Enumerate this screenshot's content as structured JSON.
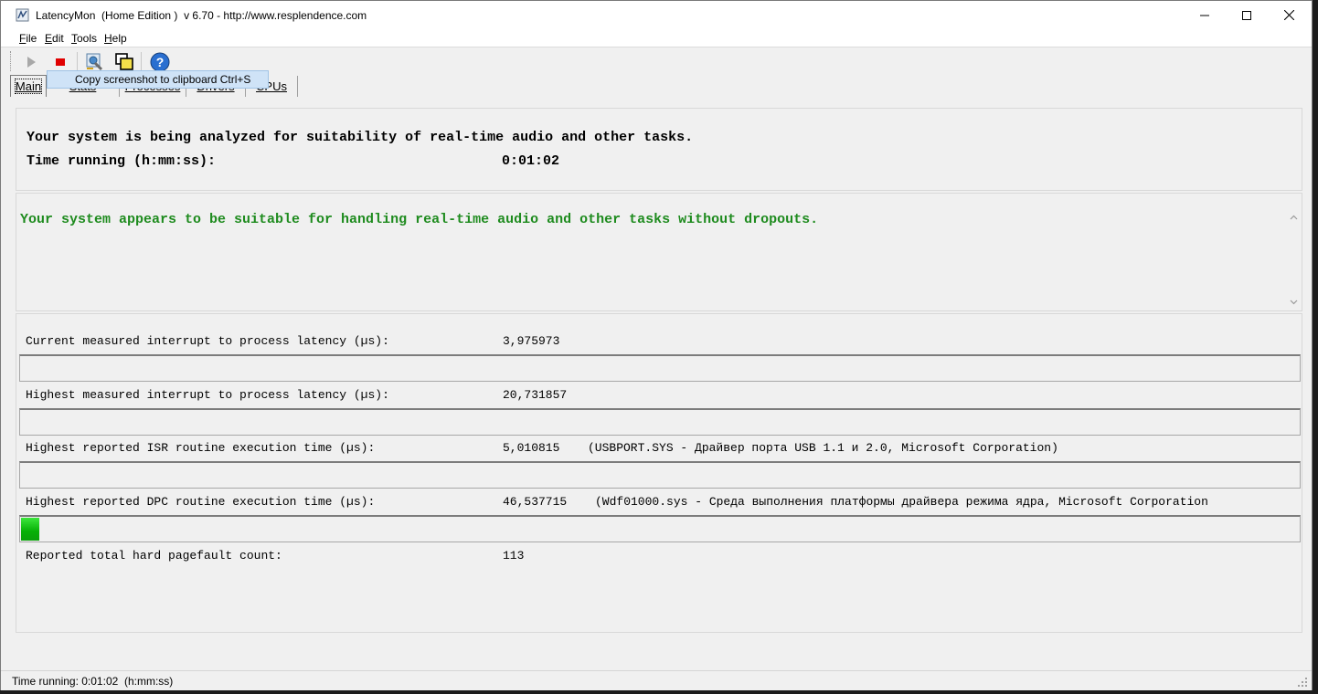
{
  "window": {
    "title": "LatencyMon  (Home Edition )  v 6.70 - http://www.resplendence.com",
    "minimize_glyph": "—",
    "maximize_glyph": "☐",
    "close_glyph": "✕"
  },
  "menu": {
    "file": {
      "u": "F",
      "rest": "ile"
    },
    "edit": {
      "u": "E",
      "rest": "dit"
    },
    "tools": {
      "u": "T",
      "rest": "ools"
    },
    "help": {
      "u": "H",
      "rest": "elp"
    }
  },
  "toolbar": {
    "icons": [
      "play-icon",
      "stop-icon",
      "gear-wrench-icon",
      "copy-windows-icon",
      "help-icon"
    ]
  },
  "tooltip": "Copy screenshot to clipboard Ctrl+S",
  "tabs": [
    {
      "label": "Main",
      "active": true
    },
    {
      "label": "Stats"
    },
    {
      "label": "Processes"
    },
    {
      "label": "Drivers"
    },
    {
      "label": "CPUs"
    }
  ],
  "summary": {
    "line1": "Your system is being analyzed for suitability of real-time audio and other tasks.",
    "time_label": "Time running (h:mm:ss):",
    "time_value": "0:01:02"
  },
  "verdict": {
    "text": "Your system appears to be suitable for handling real-time audio and other tasks without dropouts.",
    "color": "#1e8b1e"
  },
  "metrics": [
    {
      "label": "Current measured interrupt to process latency (µs):",
      "value": "3,975973",
      "extra": "",
      "bar_fill": 0.0
    },
    {
      "label": "Highest measured interrupt to process latency (µs):",
      "value": "20,731857",
      "extra": "",
      "bar_fill": 0.0
    },
    {
      "label": "Highest reported ISR routine execution time (µs):",
      "value": "5,010815",
      "extra": "(USBPORT.SYS - Драйвер порта USB 1.1 и 2.0, Microsoft Corporation)",
      "bar_fill": 0.0
    },
    {
      "label": "Highest reported DPC routine execution time (µs):",
      "value": "46,537715",
      "extra": "(Wdf01000.sys - Среда выполнения платформы драйвера режима ядра, Microsoft Corporation",
      "bar_fill": 0.0143
    }
  ],
  "pagefault": {
    "label": "Reported total hard pagefault count:",
    "value": "113"
  },
  "statusbar": {
    "text": "Time running: 0:01:02  (h:mm:ss)"
  }
}
